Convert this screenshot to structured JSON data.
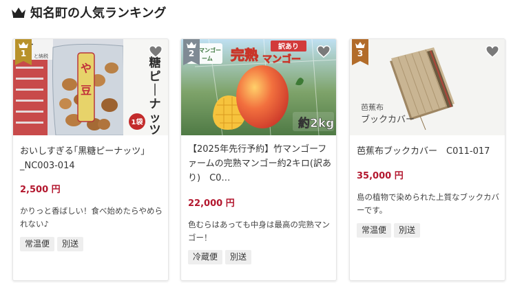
{
  "section": {
    "title": "知名町の人気ランキング"
  },
  "products": [
    {
      "rank": "1",
      "name": "おいしすぎる｢黒糖ピーナッツ｣_NC003-014",
      "price": "2,500 円",
      "description": "かりっと香ばしい！食べ始めたらやめられない♪",
      "tags": [
        "常温便",
        "別送"
      ],
      "image_text": {
        "vertical": [
          "糖",
          "ピ",
          "｜",
          "ナ",
          "ッ",
          "ツ"
        ],
        "badge": "1袋",
        "logo": "町",
        "logo_sub": "と納税"
      }
    },
    {
      "rank": "2",
      "name": "【2025年先行予約】竹マンゴーファームの完熟マンゴー約2キロ(訳あり)　C0…",
      "price": "22,000 円",
      "description": "色むらはあっても中身は最高の完熟マンゴー！",
      "tags": [
        "冷蔵便",
        "別送"
      ],
      "image_text": {
        "headline": "完熟",
        "headline2": "マンゴー",
        "flag": "訳あり",
        "weight": "約2kg",
        "logo": "マンゴー",
        "logo2": "ーム"
      }
    },
    {
      "rank": "3",
      "name": "芭蕉布ブックカバー　C011-017",
      "price": "35,000 円",
      "description": "島の植物で染められた上質なブックカバーです。",
      "tags": [
        "常温便",
        "別送"
      ],
      "image_text": {
        "line1": "芭蕉布",
        "line2": "ブックカバー"
      }
    }
  ],
  "colors": {
    "price": "#b3172e",
    "rank_gold": "#b8922b",
    "rank_silver": "#7f8a94",
    "rank_bronze": "#b26c2a"
  },
  "icons": [
    "crown-icon",
    "heart-icon"
  ]
}
